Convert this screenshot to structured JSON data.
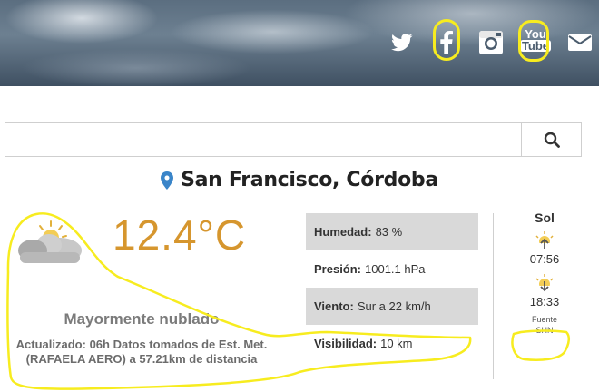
{
  "header": {
    "social": [
      {
        "name": "twitter-icon"
      },
      {
        "name": "facebook-icon"
      },
      {
        "name": "instagram-icon"
      },
      {
        "name": "youtube-icon",
        "text_top": "You",
        "text_bottom": "Tube"
      },
      {
        "name": "mail-icon"
      }
    ]
  },
  "search": {
    "value": "",
    "placeholder": "",
    "button_icon": "search-icon"
  },
  "location": {
    "icon": "map-pin-icon",
    "name": "San Francisco, Córdoba"
  },
  "weather": {
    "icon": "partly-cloudy-icon",
    "temperature": "12.4°C",
    "description": "Mayormente nublado",
    "updated": "Actualizado: 06h Datos tomados de Est. Met. (RAFAELA AERO) a 57.21km de distancia"
  },
  "stats": [
    {
      "label": "Humedad:",
      "value": "83 %"
    },
    {
      "label": "Presión:",
      "value": "1001.1 hPa"
    },
    {
      "label": "Viento:",
      "value": "Sur a 22 km/h"
    },
    {
      "label": "Visibilidad:",
      "value": "10 km"
    }
  ],
  "sun": {
    "title": "Sol",
    "sunrise": "07:56",
    "sunset": "18:33",
    "source_line1": "Fuente",
    "source_line2": "SHN"
  },
  "colors": {
    "temperature": "#d6962e",
    "annotation": "#f7ec1f",
    "pin": "#3a85c9"
  }
}
